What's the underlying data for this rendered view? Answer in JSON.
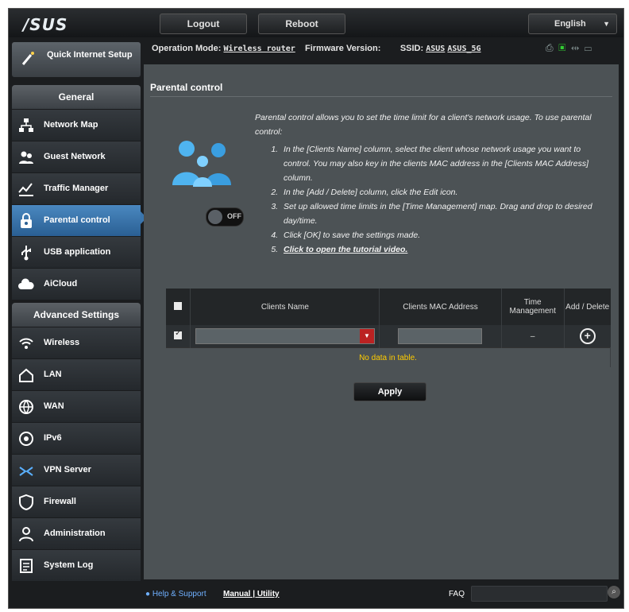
{
  "brand": {
    "logo": "/SUS"
  },
  "topbar": {
    "logout": "Logout",
    "reboot": "Reboot",
    "language": "English"
  },
  "opinfo": {
    "mode_label": "Operation Mode:",
    "mode_value": "Wireless router",
    "fw_label": "Firmware Version:",
    "ssid_label": "SSID:",
    "ssid1": "ASUS",
    "ssid2": "ASUS_5G"
  },
  "sidebar": {
    "quick_setup": "Quick Internet Setup",
    "general_header": "General",
    "general_items": [
      {
        "label": "Network Map",
        "icon": "network-map-icon"
      },
      {
        "label": "Guest Network",
        "icon": "guest-network-icon"
      },
      {
        "label": "Traffic Manager",
        "icon": "traffic-manager-icon"
      },
      {
        "label": "Parental control",
        "icon": "parental-control-icon",
        "active": true
      },
      {
        "label": "USB application",
        "icon": "usb-icon"
      },
      {
        "label": "AiCloud",
        "icon": "aicloud-icon"
      }
    ],
    "advanced_header": "Advanced Settings",
    "advanced_items": [
      {
        "label": "Wireless",
        "icon": "wireless-icon"
      },
      {
        "label": "LAN",
        "icon": "lan-icon"
      },
      {
        "label": "WAN",
        "icon": "wan-icon"
      },
      {
        "label": "IPv6",
        "icon": "ipv6-icon"
      },
      {
        "label": "VPN Server",
        "icon": "vpn-icon"
      },
      {
        "label": "Firewall",
        "icon": "firewall-icon"
      },
      {
        "label": "Administration",
        "icon": "administration-icon"
      },
      {
        "label": "System Log",
        "icon": "system-log-icon"
      }
    ]
  },
  "main": {
    "title": "Parental control",
    "toggle": "OFF",
    "intro": "Parental control allows you to set the time limit for a client's network usage. To use parental control:",
    "steps": [
      "In the [Clients Name] column, select the client whose network usage you want to control. You may also key in the clients MAC address in the [Clients MAC Address] column.",
      "In the [Add / Delete] column, click the Edit icon.",
      "Set up allowed time limits in the [Time Management] map. Drag and drop to desired day/time.",
      "Click [OK] to save the settings made."
    ],
    "tutorial_link": "Click to open the tutorial video.",
    "table": {
      "col_name": "Clients Name",
      "col_mac": "Clients MAC Address",
      "col_time": "Time Management",
      "col_add": "Add / Delete",
      "time_placeholder": "–",
      "empty": "No data in table."
    },
    "apply": "Apply"
  },
  "footer": {
    "help": "Help & Support",
    "manual": "Manual",
    "utility": "Utility",
    "faq": "FAQ"
  },
  "colors": {
    "accent": "#3a75ad",
    "panel": "#4c5255",
    "empty_text": "#ffcc00"
  }
}
